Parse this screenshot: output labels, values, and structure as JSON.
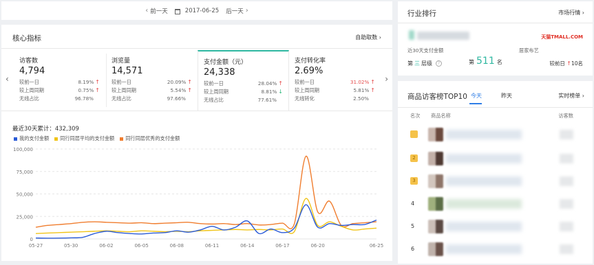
{
  "datebar": {
    "prev": "前一天",
    "date": "2017-06-25",
    "next": "后一天"
  },
  "core": {
    "title": "核心指标",
    "link": "自助取数",
    "metrics": [
      {
        "name": "访客数",
        "value": "4,794",
        "r1": "较前一日",
        "r1v": "8.19%",
        "r2": "较上周同期",
        "r2v": "0.75%",
        "r3": "无线占比",
        "r3v": "96.78%"
      },
      {
        "name": "浏览量",
        "value": "14,571",
        "r1": "较前一日",
        "r1v": "20.09%",
        "r2": "较上周同期",
        "r2v": "5.54%",
        "r3": "无线占比",
        "r3v": "97.66%"
      },
      {
        "name": "支付金额（元）",
        "value": "24,338",
        "r1": "较前一日",
        "r1v": "28.04%",
        "r2": "较上周同期",
        "r2v": "8.81%",
        "r3": "无线占比",
        "r3v": "77.61%"
      },
      {
        "name": "支付转化率",
        "value": "2.69%",
        "r1": "较前一日",
        "r1v": "31.02%",
        "r2": "较上周同期",
        "r2v": "5.81%",
        "r3": "无线转化",
        "r3v": "2.50%"
      }
    ],
    "summary": "最近30天累计：432,309",
    "legend": [
      "我的支付金额",
      "同行同层平均的支付金额",
      "同行同层优秀的支付金额"
    ],
    "colors": {
      "mine": "#2a5bd7",
      "avg": "#f0c419",
      "best": "#f07d2e",
      "accent": "#2db7a0"
    }
  },
  "chart_data": {
    "type": "line",
    "x": [
      "05-27",
      "05-28",
      "05-29",
      "05-30",
      "05-31",
      "06-01",
      "06-02",
      "06-03",
      "06-04",
      "06-05",
      "06-06",
      "06-07",
      "06-08",
      "06-09",
      "06-10",
      "06-11",
      "06-12",
      "06-13",
      "06-14",
      "06-15",
      "06-16",
      "06-17",
      "06-18",
      "06-19",
      "06-20",
      "06-21",
      "06-22",
      "06-23",
      "06-24",
      "06-25"
    ],
    "xticks": [
      "05-27",
      "05-30",
      "06-02",
      "06-05",
      "06-08",
      "06-11",
      "06-14",
      "06-17",
      "06-20",
      "06-25"
    ],
    "yticks": [
      "0",
      "25,000",
      "50,000",
      "75,000",
      "100,000"
    ],
    "ylim": [
      0,
      100000
    ],
    "series": [
      {
        "name": "我的支付金额",
        "values": [
          1000,
          800,
          900,
          1200,
          1800,
          6000,
          8500,
          7000,
          6000,
          5500,
          6500,
          7000,
          9000,
          7500,
          10000,
          14000,
          10000,
          13000,
          20000,
          6000,
          11000,
          7000,
          12000,
          38000,
          13000,
          17000,
          15000,
          16000,
          16000,
          21000
        ]
      },
      {
        "name": "同行同层平均的支付金额",
        "values": [
          6000,
          6500,
          7000,
          7500,
          8000,
          8500,
          9000,
          8500,
          8000,
          9000,
          8500,
          8000,
          8500,
          8000,
          9000,
          9500,
          10000,
          10500,
          10000,
          10500,
          10000,
          11000,
          8000,
          45000,
          15000,
          19000,
          14000,
          10000,
          11000,
          12000
        ]
      },
      {
        "name": "同行同层优秀的支付金额",
        "values": [
          13000,
          15000,
          16000,
          17000,
          18500,
          19000,
          18500,
          18000,
          17500,
          18000,
          17000,
          17500,
          18000,
          18500,
          17000,
          16500,
          17000,
          16000,
          17000,
          15500,
          16000,
          17500,
          16500,
          92000,
          30000,
          42000,
          15000,
          17000,
          18000,
          19000
        ]
      }
    ]
  },
  "rank": {
    "title": "行业排行",
    "link": "市场行情",
    "tmall": "天猫TMALL.COM",
    "label_left": "近30天支付金额",
    "label_right": "居家布艺",
    "level_pre": "第",
    "level_num": "三",
    "level_post": "层级",
    "rank_pre": "第",
    "rank_num": "511",
    "rank_post": "名",
    "cmp_pre": "较前日",
    "cmp_val": "10名"
  },
  "top10": {
    "title": "商品访客榜TOP10",
    "tab_today": "今天",
    "tab_yesterday": "昨天",
    "link": "实时榜单",
    "col_rank": "名次",
    "col_name": "商品名称",
    "col_visitors": "访客数",
    "rows": [
      {
        "rank": "1",
        "medal": true
      },
      {
        "rank": "2",
        "medal": true
      },
      {
        "rank": "3",
        "medal": true
      },
      {
        "rank": "4",
        "medal": false
      },
      {
        "rank": "5",
        "medal": false
      },
      {
        "rank": "6",
        "medal": false
      }
    ]
  }
}
